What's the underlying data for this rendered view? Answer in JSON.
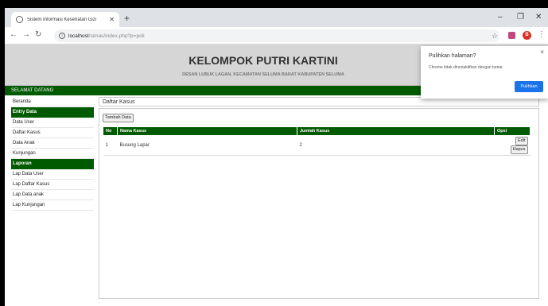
{
  "browser": {
    "tab_title": "Sistem Informasi Kesehatan Gizi",
    "new_tab": "+",
    "url_host": "localhost",
    "url_path": "/simas/index.php?p=poli",
    "minimize": "–",
    "maximize": "❐",
    "close": "✕",
    "avatar_letter": "B"
  },
  "header": {
    "title": "KELOMPOK PUTRI KARTINI",
    "subtitle": "DESAN LUBUK LAGAN, KECAMATAN SELUMA BARAT KABUPATEN SELUMA"
  },
  "welcome": "SELAMAT DATANG",
  "sidebar": {
    "beranda": "Beranda",
    "entry_head": "Entry Data",
    "entry_items": [
      "Data User",
      "Daftar Kasus",
      "Data Anak",
      "Kunjungan"
    ],
    "laporan_head": "Laporan",
    "laporan_items": [
      "Lap Data User",
      "Lap Daftar Kasus",
      "Lap Data anak",
      "Lap Kunjungan"
    ]
  },
  "content": {
    "title": "Daftar Kasus",
    "add_button": "Tambah Data",
    "columns": [
      "No",
      "Nama Kasus",
      "Jumlah Kasus",
      "Opsi"
    ],
    "rows": [
      {
        "no": "1",
        "nama": "Busung Lapar",
        "jumlah": "2",
        "edit": "Edit",
        "hapus": "Hapus"
      }
    ]
  },
  "popup": {
    "title": "Pulihkan halaman?",
    "message": "Chrome tidak dinonaktifkan dengan benar.",
    "button": "Pulihkan",
    "close": "×"
  },
  "colors": {
    "accent_green": "#005a00",
    "button_blue": "#1a73e8"
  }
}
